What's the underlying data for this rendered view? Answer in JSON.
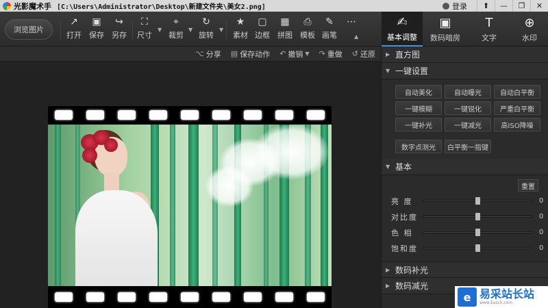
{
  "titlebar": {
    "app_name": "光影魔术手",
    "file_path": "[C:\\Users\\Administrator\\Desktop\\新建文件夹\\美女2.png]",
    "login_label": "登录",
    "buttons": [
      "⬆",
      "—",
      "❐",
      "✕"
    ]
  },
  "toolbar": {
    "browse_label": "浏览图片",
    "tools": [
      {
        "label": "打开",
        "icon": "open-icon",
        "glyph": "↗"
      },
      {
        "label": "保存",
        "icon": "save-icon",
        "glyph": "▣"
      },
      {
        "label": "另存",
        "icon": "save-as-icon",
        "glyph": "↪"
      },
      {
        "label": "尺寸",
        "icon": "resize-icon",
        "glyph": "⛶"
      },
      {
        "label": "裁剪",
        "icon": "crop-icon",
        "glyph": "⌖"
      },
      {
        "label": "旋转",
        "icon": "rotate-icon",
        "glyph": "↻"
      },
      {
        "label": "素材",
        "icon": "material-icon",
        "glyph": "★"
      },
      {
        "label": "边框",
        "icon": "border-icon",
        "glyph": "▢"
      },
      {
        "label": "拼图",
        "icon": "collage-icon",
        "glyph": "▦"
      },
      {
        "label": "模板",
        "icon": "template-icon",
        "glyph": "⎙"
      },
      {
        "label": "画笔",
        "icon": "brush-icon",
        "glyph": "✎"
      }
    ],
    "more_glyph": "⋯",
    "right_tabs": [
      {
        "label": "基本调整",
        "icon": "adjust-icon",
        "glyph": "✍"
      },
      {
        "label": "数码暗房",
        "icon": "camera-icon",
        "glyph": "▣"
      },
      {
        "label": "文字",
        "icon": "text-icon",
        "glyph": "T"
      },
      {
        "label": "水印",
        "icon": "watermark-icon",
        "glyph": "⊕"
      }
    ]
  },
  "subbar": {
    "actions": [
      {
        "label": "分享",
        "icon": "share-icon",
        "glyph": "⌥"
      },
      {
        "label": "保存动作",
        "icon": "save-action-icon",
        "glyph": "▤"
      },
      {
        "label": "撤销",
        "icon": "undo-icon",
        "glyph": "↶"
      },
      {
        "label": "重做",
        "icon": "redo-icon",
        "glyph": "↷"
      },
      {
        "label": "还原",
        "icon": "restore-icon",
        "glyph": "↺"
      }
    ]
  },
  "panel": {
    "histogram_label": "直方图",
    "one_click_label": "一键设置",
    "one_click_buttons": [
      "自动美化",
      "自动曝光",
      "自动白平衡",
      "一键模糊",
      "一键锐化",
      "严重白平衡",
      "一键补光",
      "一键减光",
      "高ISO降噪"
    ],
    "extra_buttons": [
      "数字点测光",
      "白平衡一指键"
    ],
    "basic_label": "基本",
    "reset_label": "重置",
    "sliders": [
      {
        "label": "亮 度",
        "value": "0",
        "level": 0.5
      },
      {
        "label": "对比度",
        "value": "0",
        "level": 0.5
      },
      {
        "label": "色 相",
        "value": "0",
        "level": 0.5
      },
      {
        "label": "饱和度",
        "value": "0",
        "level": 0.5
      }
    ],
    "digital_fill_label": "数码补光",
    "digital_reduce_label": "数码减光"
  },
  "watermark": {
    "title": "易采站长站",
    "url": "www.Easck.com"
  }
}
